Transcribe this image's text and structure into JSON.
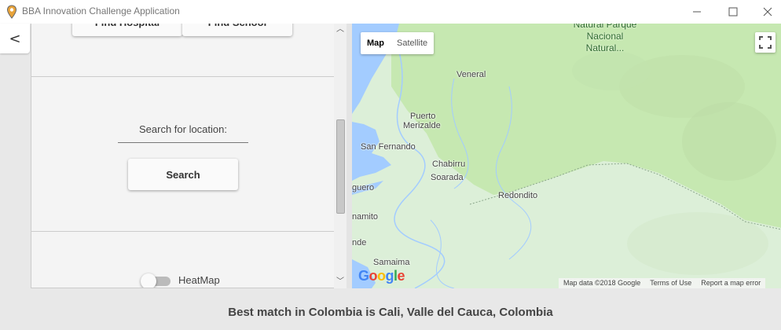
{
  "window": {
    "title": "BBA Innovation Challenge Application",
    "minimize": "—",
    "maximize": "☐",
    "close": "✕"
  },
  "nav": {
    "back": "<"
  },
  "left_panel": {
    "top_buttons": [
      "Find Hospital",
      "Find School"
    ],
    "search_label": "Search for location:",
    "search_button": "Search",
    "heatmap_label": "HeatMap",
    "heatmap_on": false
  },
  "scrollbar": {
    "up": "︿",
    "down": "﹀"
  },
  "map": {
    "type_control": {
      "map": "Map",
      "satellite": "Satellite",
      "selected": "Map"
    },
    "park_label": [
      "Natural Parque",
      "Nacional",
      "Natural..."
    ],
    "places": [
      {
        "name": "Veneral"
      },
      {
        "name": "Puerto"
      },
      {
        "name": "Merizalde"
      },
      {
        "name": "San Fernando"
      },
      {
        "name": "Chabirru"
      },
      {
        "name": "Soarada"
      },
      {
        "name": "Redondito"
      },
      {
        "name": "guero"
      },
      {
        "name": "namito"
      },
      {
        "name": "nde"
      },
      {
        "name": "Samaima"
      }
    ],
    "google_logo": "Google",
    "attribution": [
      "Map data ©2018 Google",
      "Terms of Use",
      "Report a map error"
    ],
    "colors": {
      "water": "#a3ccff",
      "park": "#c6e8b1",
      "land": "#dcefd8"
    }
  },
  "status": {
    "result": "Best match in Colombia is Cali, Valle del Cauca, Colombia"
  }
}
